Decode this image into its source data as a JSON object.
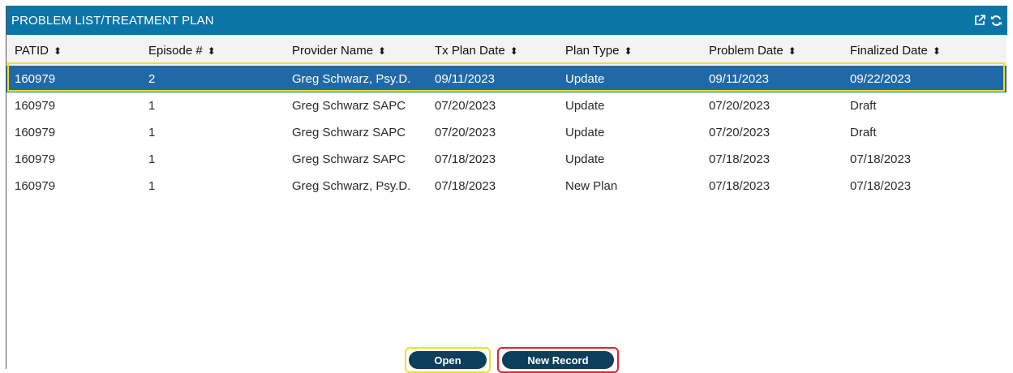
{
  "panel": {
    "title": "PROBLEM LIST/TREATMENT PLAN",
    "icons": [
      "external-link-icon",
      "refresh-icon"
    ]
  },
  "table": {
    "columns": [
      "PATID",
      "Episode #",
      "Provider Name",
      "Tx Plan Date",
      "Plan Type",
      "Problem Date",
      "Finalized Date"
    ],
    "sort_glyph": "⇕",
    "rows": [
      [
        "160979",
        "2",
        "Greg Schwarz, Psy.D.",
        "09/11/2023",
        "Update",
        "09/11/2023",
        "09/22/2023"
      ],
      [
        "160979",
        "1",
        "Greg Schwarz SAPC",
        "07/20/2023",
        "Update",
        "07/20/2023",
        "Draft"
      ],
      [
        "160979",
        "1",
        "Greg Schwarz SAPC",
        "07/20/2023",
        "Update",
        "07/20/2023",
        "Draft"
      ],
      [
        "160979",
        "1",
        "Greg Schwarz SAPC",
        "07/18/2023",
        "Update",
        "07/18/2023",
        "07/18/2023"
      ],
      [
        "160979",
        "1",
        "Greg Schwarz, Psy.D.",
        "07/18/2023",
        "New Plan",
        "07/18/2023",
        "07/18/2023"
      ]
    ],
    "selected_row": 0
  },
  "buttons": {
    "open_label": "Open",
    "new_record_label": "New Record"
  },
  "colors": {
    "header_bg": "#0c75a8",
    "selected_row_bg": "#2069a8",
    "button_bg": "#0d3e5c",
    "highlight_yellow": "#f0e020",
    "highlight_red": "#e0232e"
  }
}
